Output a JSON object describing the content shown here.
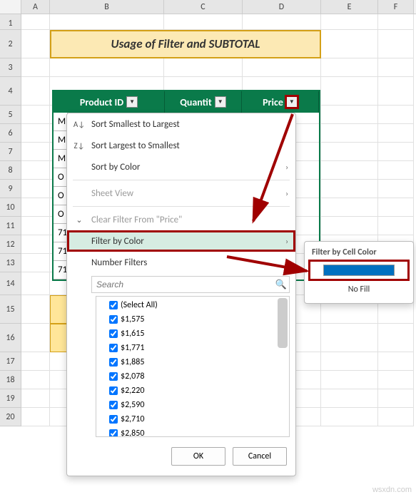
{
  "columns": [
    "A",
    "B",
    "C",
    "D",
    "E",
    "F"
  ],
  "row_labels": [
    "1",
    "2",
    "3",
    "4",
    "5",
    "6",
    "7",
    "8",
    "9",
    "10",
    "11",
    "12",
    "13",
    "14",
    "15",
    "16",
    "17",
    "18",
    "19",
    "20"
  ],
  "title": "Usage of Filter and SUBTOTAL",
  "table": {
    "headers": {
      "product": "Product ID",
      "quantity": "Quantit",
      "price": "Price"
    },
    "rows_left": [
      "M",
      "M",
      "M",
      "O",
      "O",
      "O",
      "71",
      "71",
      "71"
    ]
  },
  "menu": {
    "sort_asc": "Sort Smallest to Largest",
    "sort_desc": "Sort Largest to Smallest",
    "sort_color": "Sort by Color",
    "sheet_view": "Sheet View",
    "clear_filter": "Clear Filter From \"Price\"",
    "filter_color": "Filter by Color",
    "number_filters": "Number Filters",
    "search_placeholder": "Search",
    "checklist": [
      "(Select All)",
      "$1,575",
      "$1,615",
      "$1,771",
      "$1,885",
      "$2,078",
      "$2,220",
      "$2,590",
      "$2,710",
      "$2,850"
    ],
    "ok": "OK",
    "cancel": "Cancel"
  },
  "submenu": {
    "title": "Filter by Cell Color",
    "no_fill": "No Fill"
  },
  "watermark": "wsxdn.com"
}
